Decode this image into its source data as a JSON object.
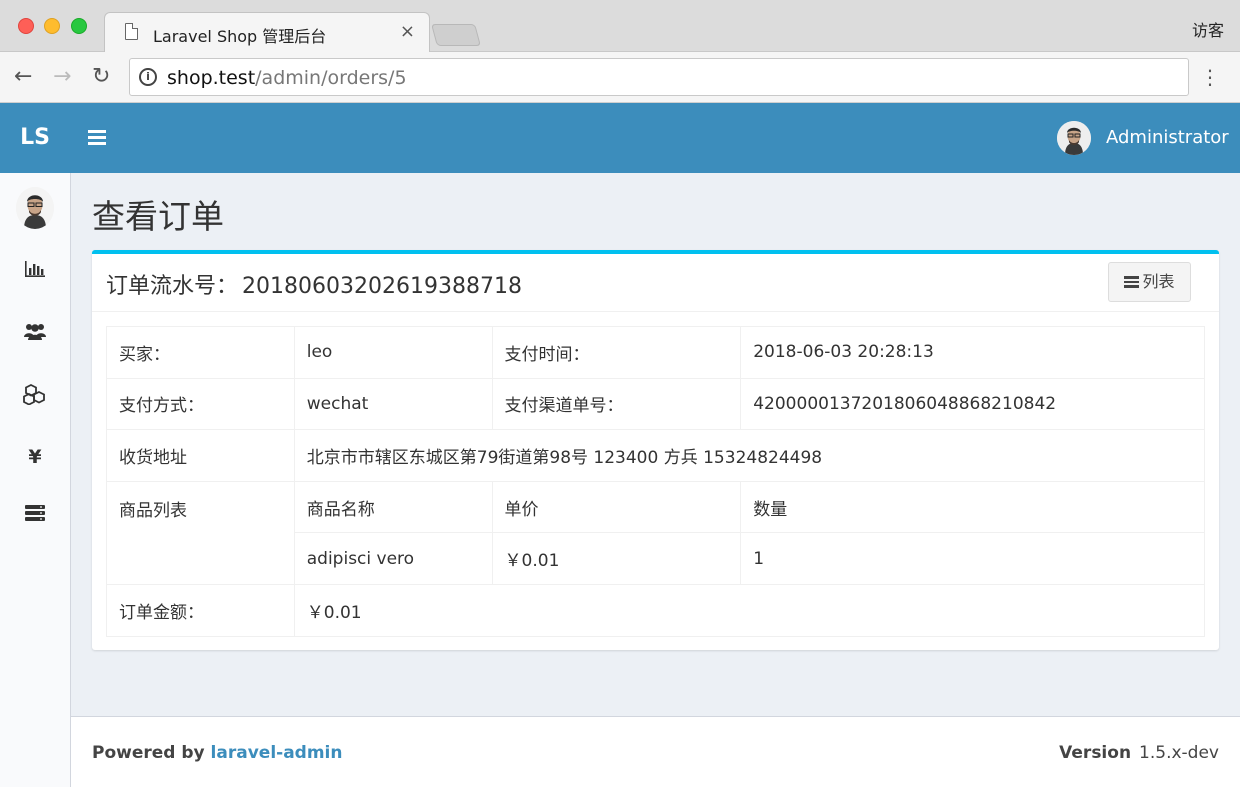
{
  "browser": {
    "tab_title": "Laravel Shop 管理后台",
    "tab_close": "×",
    "guest_label": "访客",
    "url_host": "shop.test",
    "url_path": "/admin/orders/5",
    "back": "←",
    "forward": "→",
    "reload": "↻",
    "menu": "⋮",
    "info": "i"
  },
  "header": {
    "logo": "LS",
    "user_name": "Administrator"
  },
  "sidebar": {
    "items": [
      {
        "icon": "bar-chart-icon",
        "glyph": "📊"
      },
      {
        "icon": "users-icon",
        "glyph": "👥"
      },
      {
        "icon": "cubes-icon",
        "glyph": "⬡"
      },
      {
        "icon": "yen-icon",
        "glyph": "¥"
      },
      {
        "icon": "server-icon",
        "glyph": "☰"
      }
    ]
  },
  "page": {
    "title": "查看订单"
  },
  "box": {
    "title_label": "订单流水号：",
    "order_no": "20180603202619388718",
    "list_button": "列表"
  },
  "order": {
    "buyer_label": "买家：",
    "buyer": "leo",
    "paid_at_label": "支付时间：",
    "paid_at": "2018-06-03 20:28:13",
    "payment_method_label": "支付方式：",
    "payment_method": "wechat",
    "payment_no_label": "支付渠道单号：",
    "payment_no": "4200000137201806048868210842",
    "address_label": "收货地址",
    "address": "北京市市辖区东城区第79街道第98号 123400 方兵 15324824498",
    "items_label": "商品列表",
    "items_headers": [
      "商品名称",
      "单价",
      "数量"
    ],
    "items": [
      {
        "name": "adipisci vero",
        "price": "￥0.01",
        "qty": "1"
      }
    ],
    "total_label": "订单金额：",
    "total": "￥0.01"
  },
  "footer": {
    "powered_prefix": "Powered by ",
    "powered_link": "laravel-admin",
    "version_label": "Version",
    "version": "1.5.x-dev"
  }
}
